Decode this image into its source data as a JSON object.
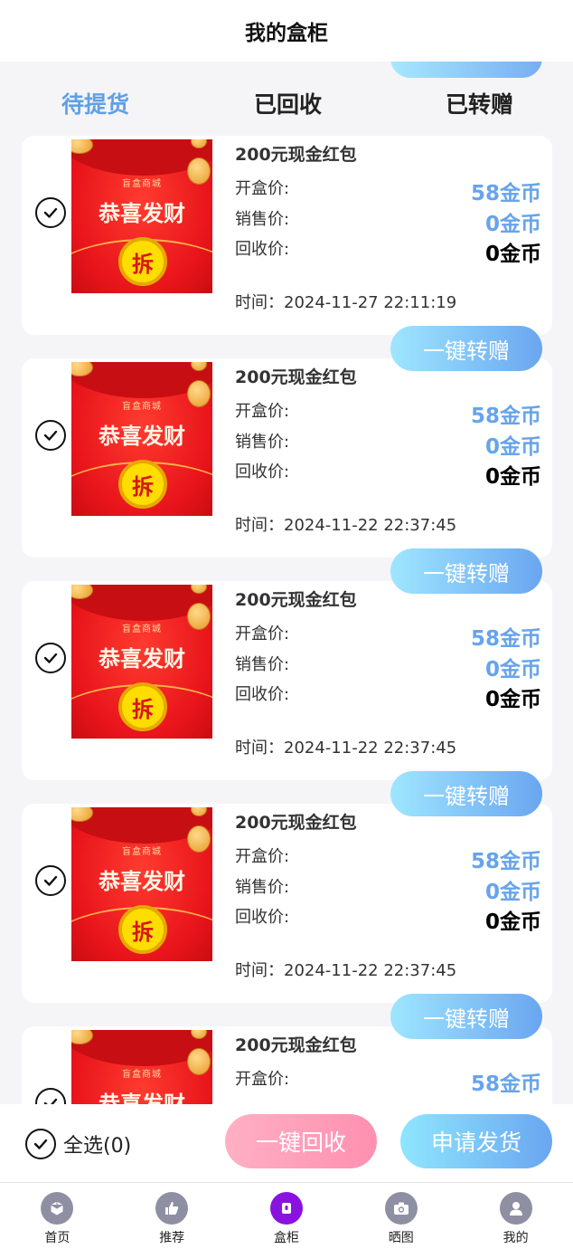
{
  "header": {
    "title": "我的盒柜"
  },
  "tabs": [
    {
      "label": "待提货",
      "active": true
    },
    {
      "label": "已回收",
      "active": false
    },
    {
      "label": "已转赠",
      "active": false
    }
  ],
  "items": [
    {
      "name": "200元现金红包",
      "open_label": "开盒价:",
      "open_value": "58金币",
      "sale_label": "销售价:",
      "sale_value": "0金币",
      "recycle_label": "回收价:",
      "recycle_value": "0金币",
      "time": "时间：2024-11-27 22:11:19",
      "gift_label": "一键转赠"
    },
    {
      "name": "200元现金红包",
      "open_label": "开盒价:",
      "open_value": "58金币",
      "sale_label": "销售价:",
      "sale_value": "0金币",
      "recycle_label": "回收价:",
      "recycle_value": "0金币",
      "time": "时间：2024-11-22 22:37:45",
      "gift_label": "一键转赠"
    },
    {
      "name": "200元现金红包",
      "open_label": "开盒价:",
      "open_value": "58金币",
      "sale_label": "销售价:",
      "sale_value": "0金币",
      "recycle_label": "回收价:",
      "recycle_value": "0金币",
      "time": "时间：2024-11-22 22:37:45",
      "gift_label": "一键转赠"
    },
    {
      "name": "200元现金红包",
      "open_label": "开盒价:",
      "open_value": "58金币",
      "sale_label": "销售价:",
      "sale_value": "0金币",
      "recycle_label": "回收价:",
      "recycle_value": "0金币",
      "time": "时间：2024-11-22 22:37:45",
      "gift_label": "一键转赠"
    },
    {
      "name": "200元现金红包",
      "open_label": "开盒价:",
      "open_value": "58金币"
    }
  ],
  "thumb": {
    "shop": "盲盒商城",
    "slogan": "恭喜发财",
    "open_char": "拆"
  },
  "footer": {
    "select_all": "全选(0)",
    "recycle_button": "一键回收",
    "ship_button": "申请发货"
  },
  "nav": [
    {
      "label": "首页",
      "icon": "cube-icon"
    },
    {
      "label": "推荐",
      "icon": "thumbs-up-icon"
    },
    {
      "label": "盒柜",
      "icon": "box-icon",
      "active": true
    },
    {
      "label": "晒图",
      "icon": "camera-icon"
    },
    {
      "label": "我的",
      "icon": "user-icon"
    }
  ],
  "colors": {
    "accent_blue": "#67a4ea",
    "nav_active": "#8a12e0",
    "recycle_pink": "#ff8fb0"
  }
}
